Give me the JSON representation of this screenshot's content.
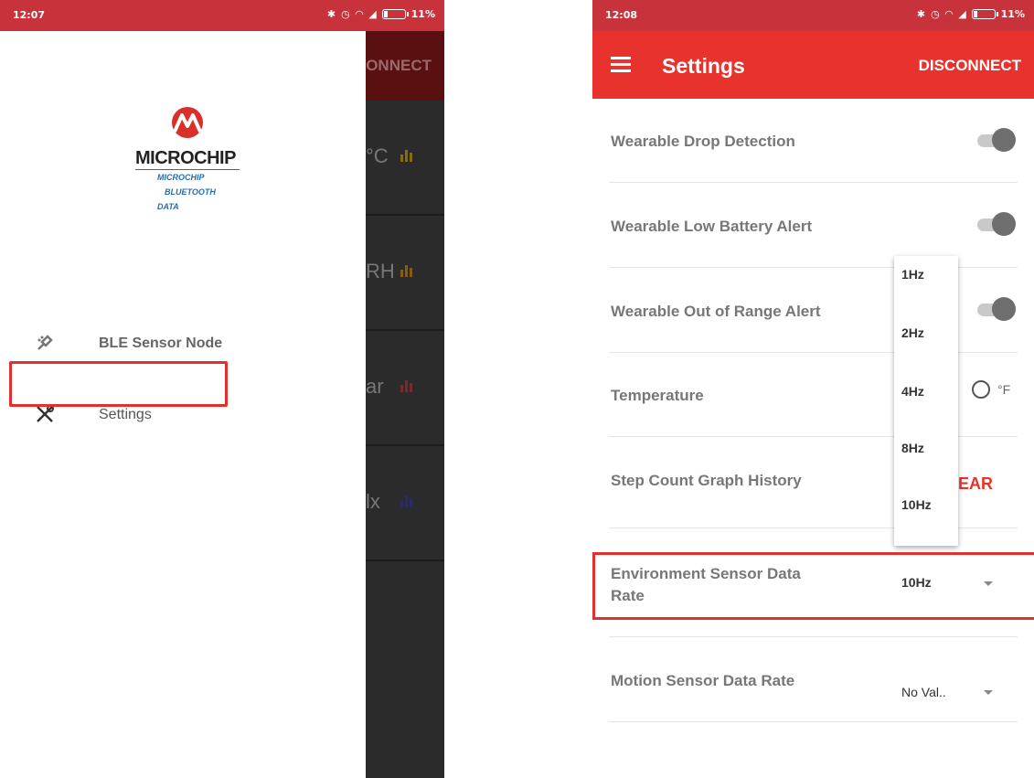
{
  "left_screen": {
    "status_bar": {
      "time": "12:07",
      "battery": "11%"
    },
    "app_bar": {
      "action_label": "DISCONNECT"
    },
    "logo": {
      "brand": "MICROCHIP",
      "line1": "MICROCHIP",
      "line2": "BLUETOOTH",
      "line3": "DATA"
    },
    "menu": {
      "ble_sensor_node": "BLE Sensor Node",
      "settings": "Settings"
    },
    "background_cards": [
      "°C",
      "RH",
      "ar",
      "lx"
    ]
  },
  "right_screen": {
    "status_bar": {
      "time": "12:08",
      "battery": "11%"
    },
    "app_bar": {
      "title": "Settings",
      "action_label": "DISCONNECT"
    },
    "settings": {
      "wearable_drop_detection": "Wearable Drop Detection",
      "wearable_low_battery_alert": "Wearable Low Battery Alert",
      "wearable_out_of_range_alert": "Wearable Out of Range Alert",
      "temperature": "Temperature",
      "temperature_unit_f": "°F",
      "step_count_graph_history": "Step Count Graph History",
      "clear_button": "EAR",
      "environment_sensor_data_rate": "Environment Sensor Data Rate",
      "environment_sensor_data_rate_value": "10Hz",
      "motion_sensor_data_rate": "Motion Sensor Data Rate",
      "motion_sensor_data_rate_value": "No Val.."
    },
    "popup_options": [
      "1Hz",
      "2Hz",
      "4Hz",
      "8Hz",
      "10Hz"
    ]
  },
  "colors": {
    "status_bar": "#c8323a",
    "app_bar": "#e8322d",
    "highlight": "#e03030"
  }
}
